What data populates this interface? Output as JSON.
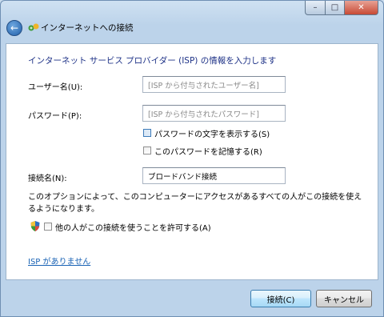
{
  "window": {
    "title": "インターネットへの接続",
    "controls": {
      "minimize": "–",
      "maximize": "□",
      "close": "✕"
    }
  },
  "page": {
    "heading": "インターネット サービス プロバイダー (ISP) の情報を入力します",
    "username": {
      "label": "ユーザー名(U):",
      "placeholder": "[ISP から付与されたユーザー名]"
    },
    "password": {
      "label": "パスワード(P):",
      "placeholder": "[ISP から付与されたパスワード]"
    },
    "show_chars_label": "パスワードの文字を表示する(S)",
    "remember_label": "このパスワードを記憶する(R)",
    "connection_name": {
      "label": "接続名(N):",
      "value": "ブロードバンド接続"
    },
    "description": "このオプションによって、このコンピューターにアクセスがあるすべての人がこの接続を使えるようになります。",
    "allow_others_label": "他の人がこの接続を使うことを許可する(A)",
    "no_isp_link": "ISP がありません"
  },
  "buttons": {
    "connect": "接続(C)",
    "cancel": "キャンセル"
  },
  "icons": {
    "back": "back-arrow-icon",
    "wizard": "network-icon",
    "shield": "uac-shield-icon"
  },
  "colors": {
    "heading": "#1e3287",
    "link": "#1a63b5",
    "accent": "#3c7fb1"
  }
}
